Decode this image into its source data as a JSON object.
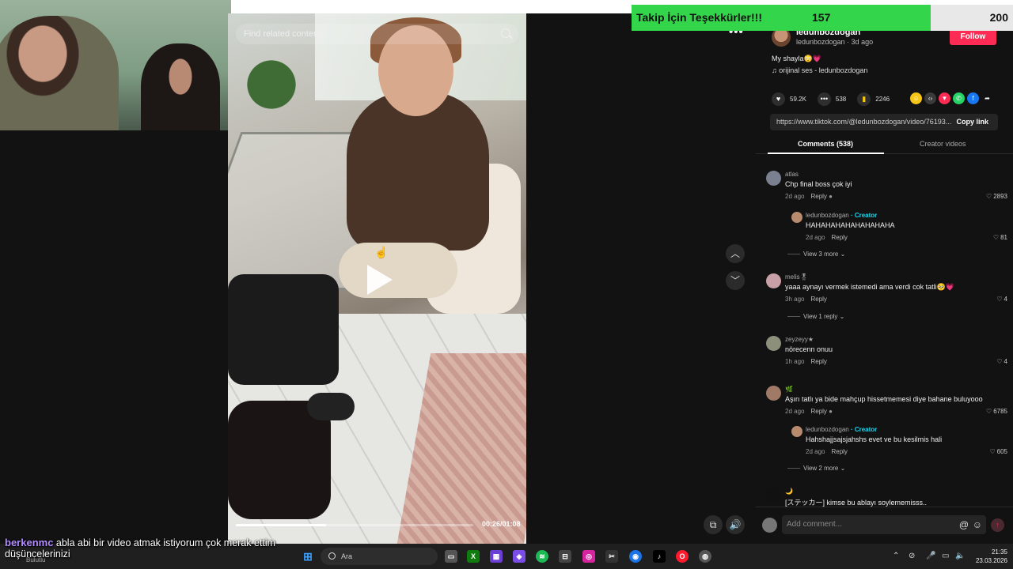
{
  "window": {
    "title": "TikTok"
  },
  "video": {
    "search_placeholder": "Find related content",
    "time": "00:26/01:08",
    "progress": 0.38
  },
  "post": {
    "username": "ledunbozdogan",
    "subline": "ledunbozdogan · 3d ago",
    "follow_label": "Follow",
    "caption": "My shayla😳💗",
    "sound": "orijinal ses - ledunbozdogan",
    "likes": "59.2K",
    "comments": "538",
    "saves": "2246",
    "url": "https://www.tiktok.com/@ledunbozdogan/video/76193...",
    "copy_label": "Copy link"
  },
  "tabs": {
    "comments": "Comments (538)",
    "creator": "Creator videos"
  },
  "comments": [
    {
      "user": "atlas",
      "text": "Chp final boss çok iyi",
      "time": "2d ago",
      "reply": "Reply",
      "likes": "2893"
    },
    {
      "user": "ledunbozdogan",
      "creator": "· Creator",
      "text": "HAHAHAHAHAHAHAHAHA",
      "time": "2d ago",
      "reply": "Reply",
      "likes": "81"
    },
    {
      "view_more": "View 3 more"
    },
    {
      "user": "melis🎖",
      "text": "yaaa aynayı vermek istemedi ama verdi cok tatli🥺💗",
      "time": "3h ago",
      "reply": "Reply",
      "likes": "4"
    },
    {
      "view_more": "View 1 reply"
    },
    {
      "user": "zeyzeyy★",
      "text": "nörecenn onuu",
      "time": "1h ago",
      "reply": "Reply",
      "likes": "4"
    },
    {
      "user": "🌿",
      "text": "Aşırı tatlı ya bide mahçup hissetmemesi diye bahane buluyooo",
      "time": "2d ago",
      "reply": "Reply",
      "likes": "6785"
    },
    {
      "user": "ledunbozdogan",
      "creator": "· Creator",
      "text": "Hahshajjsajsjahshs evet ve bu kesilmis hali",
      "time": "2d ago",
      "reply": "Reply",
      "likes": "605"
    },
    {
      "view_more": "View 2 more"
    },
    {
      "user": "🌙",
      "text": "[ステッカー] kimse bu ablayı soylememisss.."
    }
  ],
  "add_comment": {
    "placeholder": "Add comment..."
  },
  "overlay": {
    "label": "Takip İçin Teşekkürler!!!",
    "count": "157",
    "goal": "200",
    "progress": 0.785
  },
  "chat": {
    "user": "berkenmc",
    "message": "abla abi bir video atmak istiyorum çok merak ettim düşüncelerinizi"
  },
  "taskbar": {
    "weather": "Bulutlu",
    "search": "Ara",
    "time": "21:35",
    "date": "23.03.2026"
  }
}
